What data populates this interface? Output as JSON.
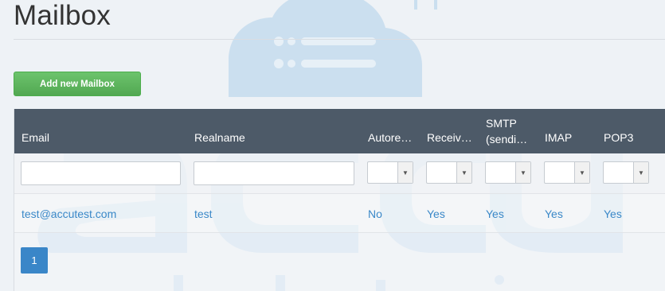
{
  "page": {
    "title": "Mailbox"
  },
  "toolbar": {
    "add_label": "Add new Mailbox"
  },
  "table": {
    "columns": [
      {
        "label": "Email"
      },
      {
        "label": "Realname"
      },
      {
        "label": "Autore…"
      },
      {
        "label": "Receiv…"
      },
      {
        "label": "SMTP\n(sendi…"
      },
      {
        "label": "IMAP"
      },
      {
        "label": "POP3"
      }
    ],
    "rows": [
      {
        "email": "test@accutest.com",
        "realname": "test",
        "autoresponder": "No",
        "receive": "Yes",
        "smtp": "Yes",
        "imap": "Yes",
        "pop3": "Yes"
      }
    ]
  },
  "pagination": {
    "current_page": "1"
  },
  "icons": {
    "select_arrow": "chevron-down-icon"
  },
  "colors": {
    "header_bg": "#4d5a68",
    "link": "#3a88c8",
    "primary": "#3a86c8",
    "success": "#5cb85c"
  }
}
